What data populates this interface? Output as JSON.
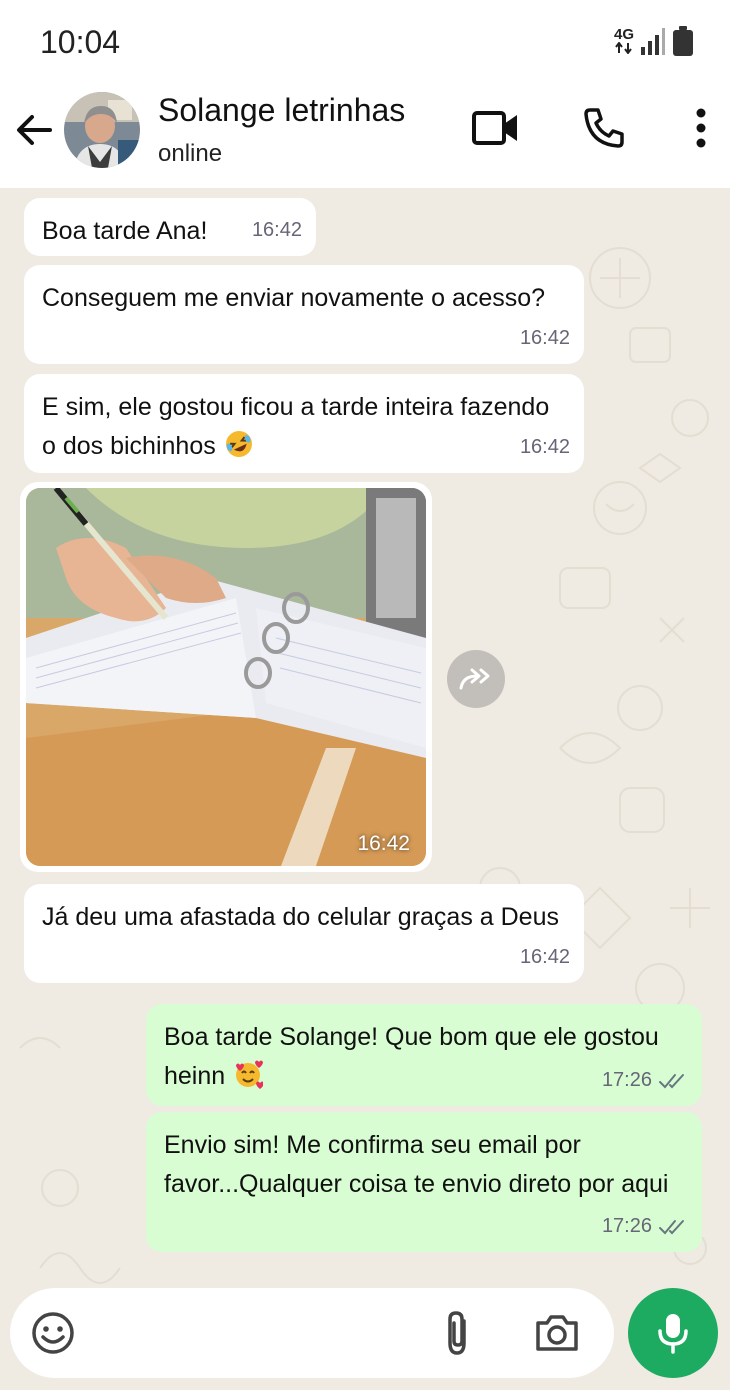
{
  "status_bar": {
    "time": "10:04",
    "network": "4G"
  },
  "header": {
    "contact_name": "Solange letrinhas",
    "contact_status": "online",
    "icons": [
      "back-arrow-icon",
      "video-call-icon",
      "voice-call-icon",
      "more-options-icon"
    ]
  },
  "messages": [
    {
      "direction": "in",
      "text": "Boa tarde Ana!",
      "time": "16:42"
    },
    {
      "direction": "in",
      "text": "Conseguem me enviar novamente o acesso?",
      "time": "16:42"
    },
    {
      "direction": "in",
      "text": "E sim, ele gostou ficou a tarde inteira fazendo o dos bichinhos",
      "emoji": "rolling-on-floor-laughing",
      "time": "16:42"
    },
    {
      "direction": "in",
      "type": "image",
      "time": "16:42"
    },
    {
      "direction": "in",
      "text": "Já deu uma afastada do celular graças a Deus",
      "time": "16:42"
    },
    {
      "direction": "out",
      "text": "Boa tarde Solange! Que bom que ele gostou heinn",
      "emoji": "smiling-face-with-hearts",
      "time": "17:26",
      "status": "read"
    },
    {
      "direction": "out",
      "text": "Envio sim! Me confirma seu email por favor...Qualquer coisa te envio direto por aqui",
      "time": "17:26",
      "status": "read"
    }
  ],
  "input_bar": {
    "icons": [
      "emoji-icon",
      "attach-icon",
      "camera-icon",
      "mic-icon"
    ]
  },
  "colors": {
    "chat_bg": "#efeae2",
    "outgoing_bubble": "#d9fdd3",
    "incoming_bubble": "#ffffff",
    "mic_button": "#1daa61",
    "read_ticks": "#667781"
  }
}
